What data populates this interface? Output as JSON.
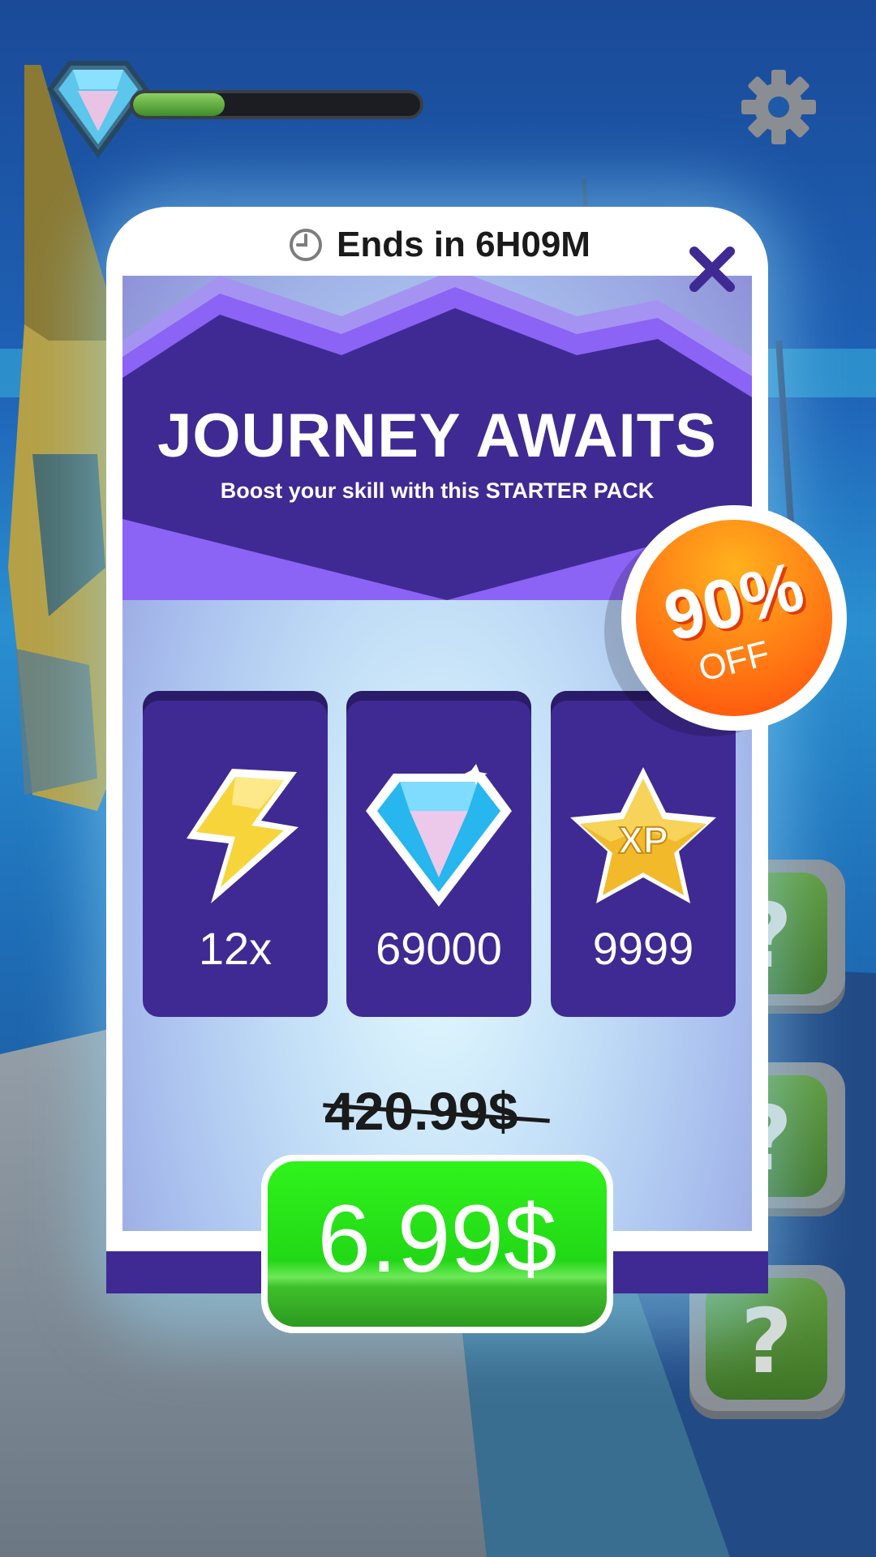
{
  "hud": {
    "gem_icon": "diamond-icon",
    "progress_fraction": 0.32,
    "settings_icon": "gear-icon"
  },
  "side_buttons": [
    {
      "icon": "question-mark-icon",
      "label": "?"
    },
    {
      "icon": "question-mark-icon",
      "label": "?"
    },
    {
      "icon": "question-mark-icon",
      "label": "?"
    }
  ],
  "offer": {
    "timer_icon": "clock-icon",
    "timer_text": "Ends in 6H09M",
    "close_icon": "close-icon",
    "title": "JOURNEY AWAITS",
    "subtitle": "Boost your skill with this STARTER PACK",
    "badge": {
      "percent": "90%",
      "off": "OFF"
    },
    "items": [
      {
        "icon": "lightning-bolt-icon",
        "value": "12x"
      },
      {
        "icon": "diamond-icon",
        "value": "69000"
      },
      {
        "icon": "xp-star-icon",
        "value": "9999"
      }
    ],
    "old_price": "420.99$",
    "price": "6.99$"
  },
  "colors": {
    "panel_purple": "#3f2a93",
    "banner_edge": "#8e63f5",
    "buy_green": "#2ff31b",
    "badge_orange": "#ff6a10",
    "close_x": "#3f2a93"
  }
}
